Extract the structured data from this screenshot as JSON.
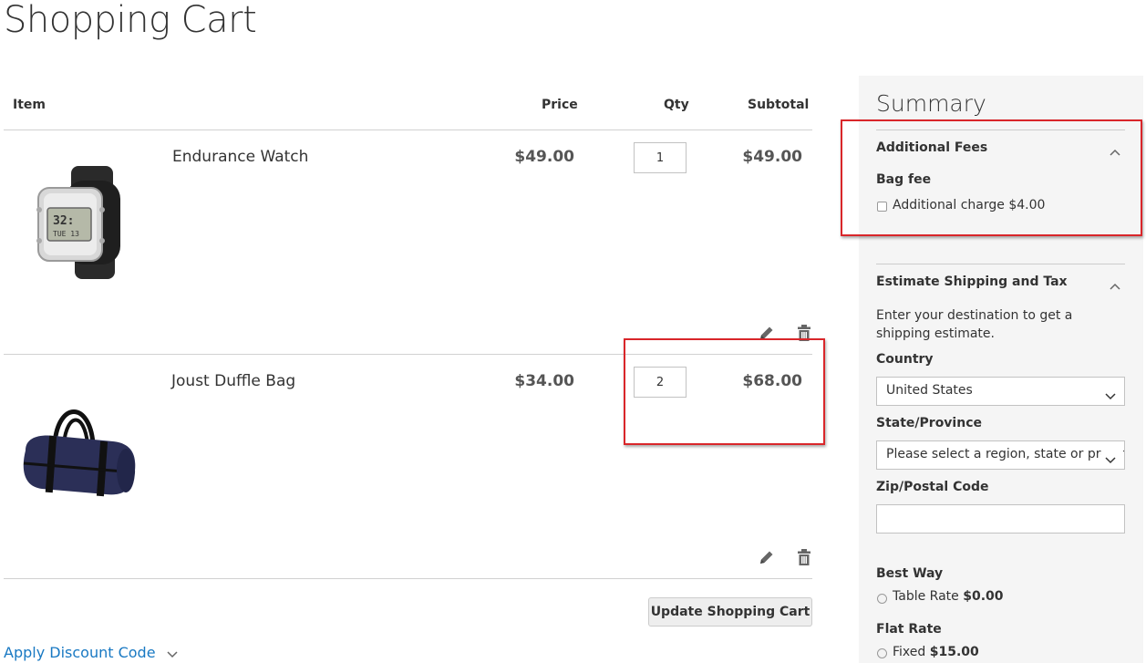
{
  "page": {
    "title": "Shopping Cart"
  },
  "cart": {
    "headers": {
      "item": "Item",
      "price": "Price",
      "qty": "Qty",
      "subtotal": "Subtotal"
    },
    "items": [
      {
        "name": "Endurance Watch",
        "price": "$49.00",
        "qty": "1",
        "subtotal": "$49.00",
        "image": "watch-image"
      },
      {
        "name": "Joust Duffle Bag",
        "price": "$34.00",
        "qty": "2",
        "subtotal": "$68.00",
        "image": "duffle-bag-image"
      }
    ],
    "update_button": "Update Shopping Cart",
    "discount_link": "Apply Discount Code"
  },
  "summary": {
    "title": "Summary",
    "additional_fees": {
      "title": "Additional Fees",
      "group_label": "Bag fee",
      "option_label": "Additional charge $4.00"
    },
    "estimate": {
      "title": "Estimate Shipping and Tax",
      "description": "Enter your destination to get a shipping estimate.",
      "country_label": "Country",
      "country_value": "United States",
      "state_label": "State/Province",
      "state_placeholder": "Please select a region, state or province.",
      "zip_label": "Zip/Postal Code",
      "zip_value": "",
      "methods": [
        {
          "carrier": "Best Way",
          "method": "Table Rate",
          "price": "$0.00"
        },
        {
          "carrier": "Flat Rate",
          "method": "Fixed",
          "price": "$15.00"
        }
      ]
    }
  },
  "colors": {
    "accent_link": "#1979c3",
    "highlight_box": "#d9262a",
    "summary_bg": "#f5f5f5"
  },
  "icons": [
    "pencil-icon",
    "trash-icon",
    "chevron-up-icon",
    "chevron-down-icon"
  ]
}
